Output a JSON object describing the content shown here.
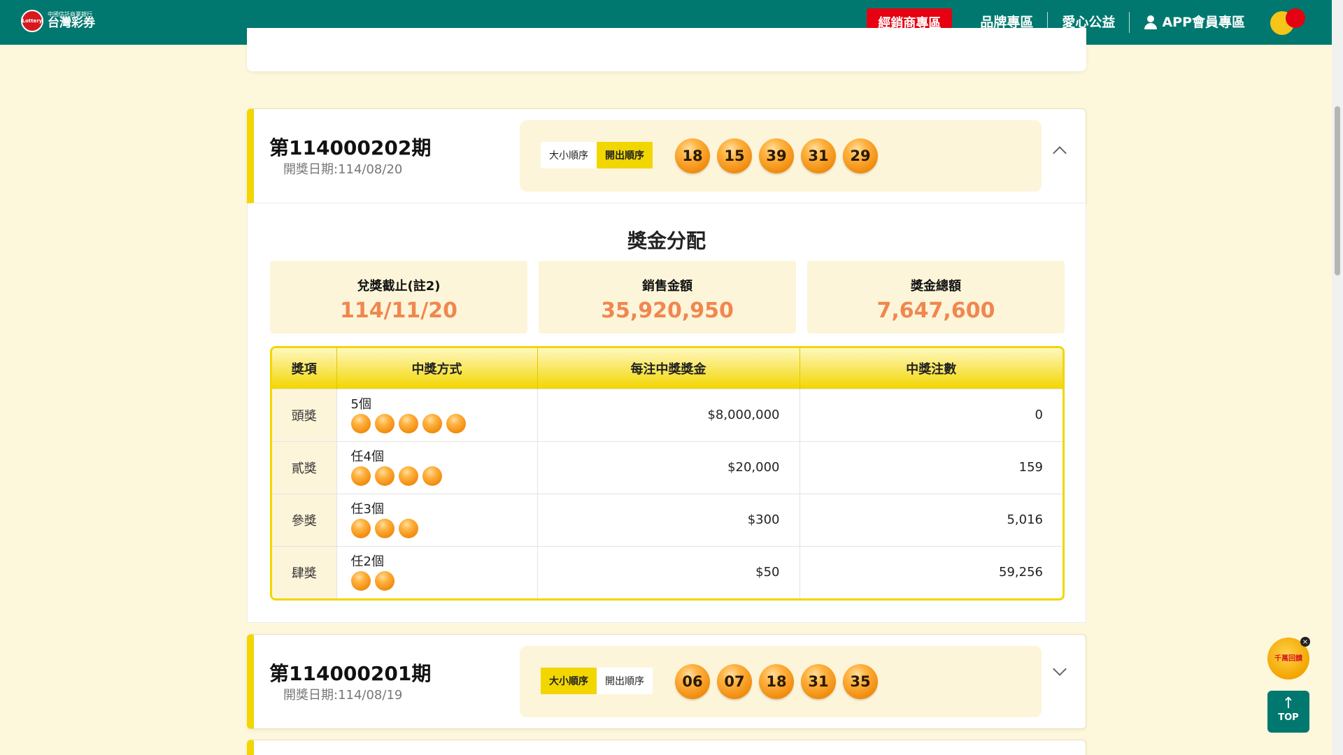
{
  "header": {
    "logo_sub": "中國信託商業銀行",
    "logo_main": "台灣彩券",
    "logo_badge": "Lottery",
    "nav": {
      "dealer": "經銷商專區",
      "brand": "品牌專區",
      "charity": "愛心公益",
      "member": "APP會員專區"
    }
  },
  "draws": [
    {
      "title": "第114000202期",
      "date": "開獎日期:114/08/20",
      "order_size": "大小順序",
      "order_draw": "開出順序",
      "active_order": "draw",
      "balls": [
        "18",
        "15",
        "39",
        "31",
        "29"
      ],
      "expanded": true
    },
    {
      "title": "第114000201期",
      "date": "開獎日期:114/08/19",
      "order_size": "大小順序",
      "order_draw": "開出順序",
      "active_order": "size",
      "balls": [
        "06",
        "07",
        "18",
        "31",
        "35"
      ],
      "expanded": false
    }
  ],
  "prize": {
    "title": "獎金分配",
    "stats": [
      {
        "label": "兌獎截止(註2)",
        "value": "114/11/20"
      },
      {
        "label": "銷售金額",
        "value": "35,920,950"
      },
      {
        "label": "獎金總額",
        "value": "7,647,600"
      }
    ],
    "columns": [
      "獎項",
      "中獎方式",
      "每注中獎獎金",
      "中獎注數"
    ],
    "rows": [
      {
        "name": "頭獎",
        "method": "5個",
        "balls": 5,
        "amount": "$8,000,000",
        "count": "0"
      },
      {
        "name": "貳獎",
        "method": "任4個",
        "balls": 4,
        "amount": "$20,000",
        "count": "159"
      },
      {
        "name": "參獎",
        "method": "任3個",
        "balls": 3,
        "amount": "$300",
        "count": "5,016"
      },
      {
        "name": "肆獎",
        "method": "任2個",
        "balls": 2,
        "amount": "$50",
        "count": "59,256"
      }
    ]
  },
  "floating": {
    "promo_text": "千萬回饋",
    "close": "×",
    "top_arrow": "↑",
    "top_label": "TOP"
  },
  "colors": {
    "header": "#00786f",
    "accent_yellow": "#f2d600",
    "dealer_red": "#e60012",
    "value_orange": "#f0874f",
    "page_bg": "#fdf7dc"
  }
}
